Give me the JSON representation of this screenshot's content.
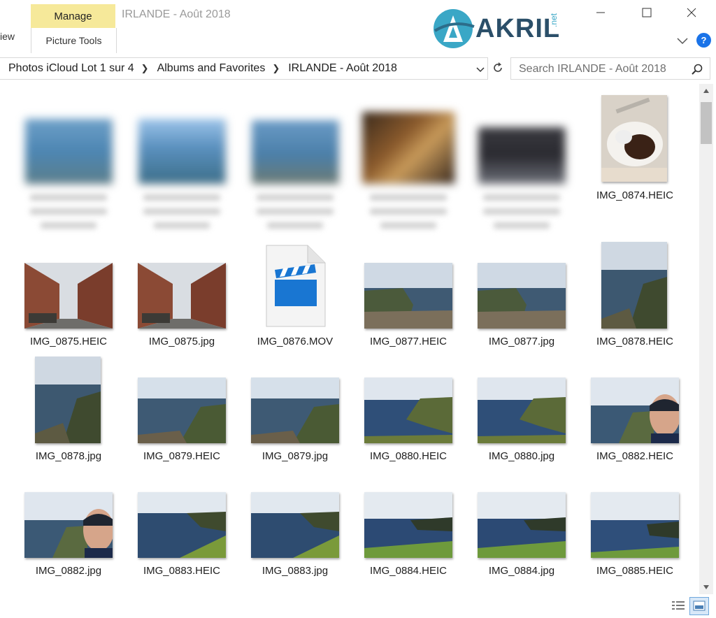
{
  "ribbon": {
    "partial_tab": "iew",
    "manage_tab": "Manage",
    "picture_tools": "Picture Tools",
    "window_title": "IRLANDE - Août 2018",
    "help": "?"
  },
  "logo": {
    "text": "AKRIL",
    "suffix": ".net"
  },
  "address": {
    "breadcrumbs": [
      "Photos iCloud Lot 1 sur 4",
      "Albums and Favorites",
      "IRLANDE - Août 2018"
    ]
  },
  "search": {
    "placeholder": "Search IRLANDE - Août 2018"
  },
  "files": {
    "row1": [
      "",
      "",
      "",
      "",
      "",
      "IMG_0874.HEIC"
    ],
    "row2": [
      "IMG_0875.HEIC",
      "IMG_0875.jpg",
      "IMG_0876.MOV",
      "IMG_0877.HEIC",
      "IMG_0877.jpg",
      "IMG_0878.HEIC"
    ],
    "row3": [
      "IMG_0878.jpg",
      "IMG_0879.HEIC",
      "IMG_0879.jpg",
      "IMG_0880.HEIC",
      "IMG_0880.jpg",
      "IMG_0882.HEIC"
    ],
    "row4": [
      "IMG_0882.jpg",
      "IMG_0883.HEIC",
      "IMG_0883.jpg",
      "IMG_0884.HEIC",
      "IMG_0884.jpg",
      "IMG_0885.HEIC"
    ]
  },
  "icons": {
    "minimize": "minimize-icon",
    "maximize": "maximize-icon",
    "close": "close-icon",
    "refresh": "refresh-icon",
    "search": "search-icon",
    "video": "video-file-icon"
  },
  "colors": {
    "manage_tab": "#f6e99a",
    "help": "#1a73e8",
    "video_icon": "#1976d2"
  }
}
